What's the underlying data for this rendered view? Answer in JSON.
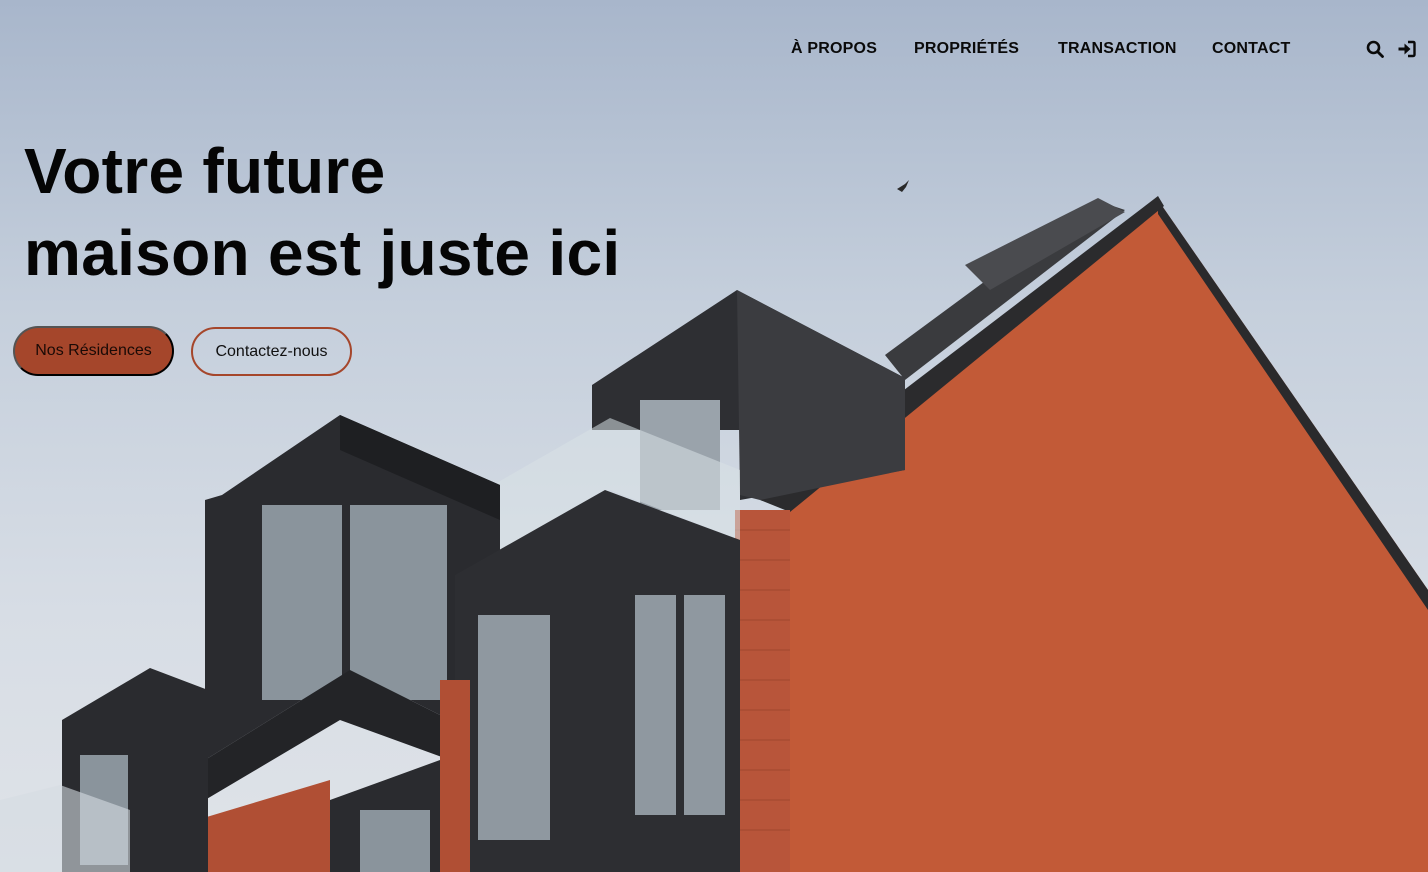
{
  "nav": {
    "items": [
      {
        "label": "À PROPOS"
      },
      {
        "label": "PROPRIÉTÉS"
      },
      {
        "label": "TRANSACTION"
      },
      {
        "label": "CONTACT"
      }
    ],
    "icons": {
      "search": "search-icon",
      "login": "sign-in-icon"
    }
  },
  "hero": {
    "headline_line1": "Votre future",
    "headline_line2": "maison est juste ici",
    "primary_button": "Nos Résidences",
    "secondary_button": "Contactez-nous"
  },
  "colors": {
    "accent": "#a5462b",
    "text": "#050505"
  }
}
